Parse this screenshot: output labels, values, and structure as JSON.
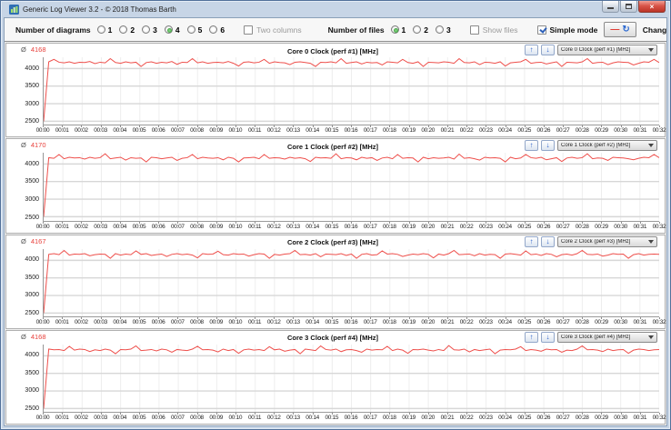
{
  "window": {
    "title": "Generic Log Viewer 3.2 - © 2018 Thomas Barth"
  },
  "icons": {
    "minimize": "minimize-icon",
    "maximize": "maximize-icon",
    "close_glyph": "×",
    "refresh_glyph": "↻",
    "dash_glyph": "—",
    "up_glyph": "↑",
    "down_glyph": "↓",
    "avg_symbol": "Ø"
  },
  "toolbar": {
    "diagrams_label": "Number of diagrams",
    "diagram_options": [
      "1",
      "2",
      "3",
      "4",
      "5",
      "6"
    ],
    "diagram_selected": "4",
    "two_columns_label": "Two columns",
    "two_columns_checked": false,
    "files_label": "Number of files",
    "file_options": [
      "1",
      "2",
      "3"
    ],
    "file_selected": "1",
    "show_files_label": "Show files",
    "show_files_checked": false,
    "simple_mode_label": "Simple mode",
    "simple_mode_checked": true,
    "change_all_label": "Change all"
  },
  "axes": {
    "x_labels": [
      "00:00",
      "00:01",
      "00:02",
      "00:03",
      "00:04",
      "00:05",
      "00:06",
      "00:07",
      "00:08",
      "00:09",
      "00:10",
      "00:11",
      "00:12",
      "00:13",
      "00:14",
      "00:15",
      "00:16",
      "00:17",
      "00:18",
      "00:19",
      "00:20",
      "00:21",
      "00:22",
      "00:23",
      "00:24",
      "00:25",
      "00:26",
      "00:27",
      "00:28",
      "00:29",
      "00:30",
      "00:31",
      "00:32"
    ],
    "y_ticks": [
      4000,
      3500,
      3000,
      2500
    ],
    "y_range": [
      2400,
      4320
    ]
  },
  "chart_data": [
    {
      "type": "line",
      "title": "Core 0 Clock (perf #1) [MHz]",
      "average": "4168",
      "dropdown_label": "Core 0 Clock (perf #1) [MHz]",
      "unit": "MHz",
      "line_color": "#ee4f4b",
      "xlabel": "",
      "ylabel": "MHz",
      "ylim": [
        2400,
        4320
      ],
      "values": [
        2500,
        4190,
        4260,
        4180,
        4160,
        4190,
        4150,
        4180,
        4170,
        4200,
        4140,
        4180,
        4160,
        4280,
        4170,
        4150,
        4190,
        4160,
        4180,
        4060,
        4170,
        4190,
        4150,
        4180,
        4160,
        4200,
        4120,
        4180,
        4170,
        4280,
        4160,
        4190,
        4150,
        4170,
        4180,
        4160,
        4200,
        4150,
        4070,
        4180,
        4190,
        4160,
        4180,
        4260,
        4150,
        4190,
        4170,
        4160,
        4110,
        4180,
        4190,
        4170,
        4150,
        4060,
        4180,
        4170,
        4190,
        4160,
        4280,
        4150,
        4170,
        4190,
        4130,
        4180,
        4160,
        4170,
        4100,
        4190,
        4180,
        4160,
        4260,
        4170,
        4150,
        4190,
        4060,
        4180,
        4170,
        4160,
        4190,
        4180,
        4150,
        4280,
        4170,
        4160,
        4190,
        4110,
        4180,
        4170,
        4150,
        4190,
        4070,
        4160,
        4180,
        4190,
        4260,
        4150,
        4170,
        4180,
        4130,
        4160,
        4190,
        4060,
        4180,
        4170,
        4160,
        4190,
        4280,
        4150,
        4170,
        4180,
        4110,
        4160,
        4190,
        4180,
        4170,
        4100,
        4150,
        4190,
        4180,
        4260,
        4170
      ]
    },
    {
      "type": "line",
      "title": "Core 1 Clock (perf #2) [MHz]",
      "average": "4170",
      "dropdown_label": "Core 1 Clock (perf #2) [MHz]",
      "unit": "MHz",
      "line_color": "#ee4f4b",
      "xlabel": "",
      "ylabel": "MHz",
      "ylim": [
        2400,
        4320
      ],
      "values": [
        2500,
        4180,
        4160,
        4270,
        4150,
        4190,
        4170,
        4180,
        4140,
        4190,
        4160,
        4180,
        4290,
        4150,
        4170,
        4190,
        4110,
        4180,
        4160,
        4170,
        4060,
        4190,
        4180,
        4150,
        4170,
        4190,
        4100,
        4160,
        4180,
        4270,
        4150,
        4190,
        4170,
        4160,
        4180,
        4120,
        4190,
        4160,
        4060,
        4170,
        4180,
        4190,
        4150,
        4270,
        4160,
        4180,
        4170,
        4140,
        4190,
        4160,
        4180,
        4150,
        4070,
        4190,
        4170,
        4180,
        4160,
        4290,
        4150,
        4180,
        4170,
        4120,
        4190,
        4160,
        4180,
        4100,
        4170,
        4190,
        4150,
        4270,
        4160,
        4180,
        4170,
        4060,
        4190,
        4150,
        4180,
        4160,
        4170,
        4190,
        4140,
        4280,
        4160,
        4180,
        4150,
        4110,
        4190,
        4170,
        4180,
        4160,
        4060,
        4190,
        4150,
        4170,
        4270,
        4180,
        4160,
        4190,
        4120,
        4150,
        4180,
        4070,
        4170,
        4190,
        4160,
        4180,
        4290,
        4150,
        4170,
        4160,
        4100,
        4190,
        4180,
        4170,
        4150,
        4120,
        4160,
        4190,
        4180,
        4270,
        4180
      ]
    },
    {
      "type": "line",
      "title": "Core 2 Clock (perf #3) [MHz]",
      "average": "4167",
      "dropdown_label": "Core 2 Clock (perf #3) [MHz]",
      "unit": "MHz",
      "line_color": "#ee4f4b",
      "xlabel": "",
      "ylabel": "MHz",
      "ylim": [
        2400,
        4320
      ],
      "values": [
        2500,
        4170,
        4190,
        4160,
        4280,
        4150,
        4180,
        4170,
        4190,
        4130,
        4160,
        4180,
        4170,
        4060,
        4190,
        4150,
        4180,
        4160,
        4270,
        4170,
        4190,
        4140,
        4160,
        4180,
        4110,
        4170,
        4190,
        4160,
        4180,
        4150,
        4070,
        4190,
        4170,
        4180,
        4260,
        4160,
        4150,
        4190,
        4170,
        4180,
        4120,
        4160,
        4190,
        4180,
        4060,
        4170,
        4150,
        4180,
        4190,
        4280,
        4160,
        4170,
        4150,
        4190,
        4100,
        4180,
        4170,
        4160,
        4190,
        4140,
        4180,
        4060,
        4170,
        4190,
        4150,
        4160,
        4270,
        4180,
        4190,
        4170,
        4110,
        4150,
        4180,
        4160,
        4190,
        4170,
        4070,
        4180,
        4150,
        4190,
        4280,
        4160,
        4170,
        4180,
        4130,
        4190,
        4150,
        4170,
        4160,
        4060,
        4180,
        4190,
        4170,
        4150,
        4270,
        4160,
        4180,
        4140,
        4190,
        4170,
        4100,
        4160,
        4180,
        4150,
        4190,
        4280,
        4170,
        4160,
        4180,
        4120,
        4150,
        4190,
        4170,
        4180,
        4060,
        4160,
        4190,
        4150,
        4170,
        4180,
        4170
      ]
    },
    {
      "type": "line",
      "title": "Core 3 Clock (perf #4) [MHz]",
      "average": "4168",
      "dropdown_label": "Core 3 Clock (perf #4) [MHz]",
      "unit": "MHz",
      "line_color": "#ee4f4b",
      "xlabel": "",
      "ylabel": "MHz",
      "ylim": [
        2400,
        4320
      ],
      "values": [
        2500,
        4190,
        4170,
        4180,
        4150,
        4270,
        4160,
        4190,
        4180,
        4120,
        4170,
        4150,
        4190,
        4160,
        4060,
        4180,
        4170,
        4190,
        4280,
        4150,
        4160,
        4180,
        4140,
        4190,
        4170,
        4100,
        4180,
        4160,
        4150,
        4190,
        4270,
        4170,
        4180,
        4160,
        4110,
        4190,
        4150,
        4180,
        4070,
        4170,
        4190,
        4160,
        4180,
        4150,
        4260,
        4170,
        4190,
        4130,
        4160,
        4180,
        4060,
        4190,
        4170,
        4150,
        4280,
        4180,
        4160,
        4190,
        4120,
        4170,
        4180,
        4150,
        4100,
        4190,
        4160,
        4180,
        4170,
        4270,
        4150,
        4190,
        4160,
        4070,
        4180,
        4170,
        4190,
        4160,
        4140,
        4180,
        4150,
        4290,
        4170,
        4160,
        4190,
        4110,
        4180,
        4150,
        4170,
        4190,
        4060,
        4160,
        4180,
        4170,
        4190,
        4260,
        4150,
        4180,
        4160,
        4130,
        4190,
        4170,
        4180,
        4100,
        4160,
        4150,
        4190,
        4280,
        4170,
        4180,
        4160,
        4120,
        4190,
        4150,
        4170,
        4180,
        4070,
        4160,
        4190,
        4180,
        4150,
        4170,
        4180
      ]
    }
  ]
}
